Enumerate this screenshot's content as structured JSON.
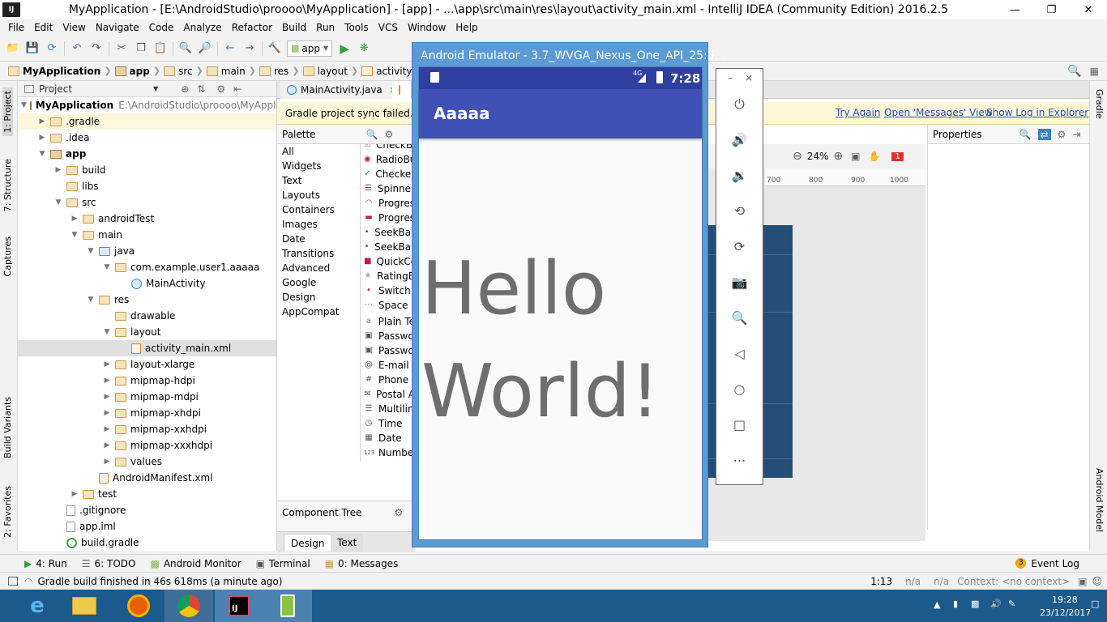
{
  "window": {
    "title": "MyApplication - [E:\\AndroidStudio\\proooo\\MyApplication] - [app] - ...\\app\\src\\main\\res\\layout\\activity_main.xml - IntelliJ IDEA (Community Edition) 2016.2.5",
    "min": "—",
    "max": "❐",
    "close": "✕"
  },
  "menu": [
    "File",
    "Edit",
    "View",
    "Navigate",
    "Code",
    "Analyze",
    "Refactor",
    "Build",
    "Run",
    "Tools",
    "VCS",
    "Window",
    "Help"
  ],
  "toolbar": {
    "run_config": "app"
  },
  "breadcrumb": [
    "MyApplication",
    "app",
    "src",
    "main",
    "res",
    "layout",
    "activity_main.xml"
  ],
  "left_tabs": [
    "1: Project",
    "7: Structure",
    "Captures",
    "Build Variants",
    "2: Favorites"
  ],
  "right_tabs": [
    "Gradle",
    "Android Model"
  ],
  "project_panel": {
    "header": "Project",
    "root_label": "MyApplication",
    "root_path": "E:\\AndroidStudio\\proooo\\MyApplica",
    "items": [
      ".gradle",
      ".idea",
      "app",
      "build",
      "libs",
      "src",
      "androidTest",
      "main",
      "java",
      "com.example.user1.aaaaa",
      "MainActivity",
      "res",
      "drawable",
      "layout",
      "activity_main.xml",
      "layout-xlarge",
      "mipmap-hdpi",
      "mipmap-mdpi",
      "mipmap-xhdpi",
      "mipmap-xxhdpi",
      "mipmap-xxxhdpi",
      "values",
      "AndroidManifest.xml",
      "test",
      ".gitignore",
      "app.iml",
      "build.gradle"
    ]
  },
  "editor_tabs": [
    "MainActivity.java"
  ],
  "notification": {
    "message": "Gradle project sync failed. Bas",
    "actions": [
      "Try Again",
      "Open 'Messages' View",
      "Show Log in Explorer"
    ]
  },
  "palette": {
    "header": "Palette",
    "categories": [
      "All",
      "Widgets",
      "Text",
      "Layouts",
      "Containers",
      "Images",
      "Date",
      "Transitions",
      "Advanced",
      "Google",
      "Design",
      "AppCompat"
    ],
    "items": [
      "CheckBo",
      "RadioBu",
      "Checked",
      "Spinner",
      "Progres",
      "Progres",
      "SeekBar",
      "SeekBar",
      "QuickCo",
      "RatingB",
      "Switch",
      "Space",
      "Plain Te",
      "Passwo",
      "Passwo",
      "E-mail",
      "Phone",
      "Postal A",
      "Multilin",
      "Time",
      "Date",
      "Numbe"
    ]
  },
  "component_tree": {
    "header": "Component Tree"
  },
  "design_tabs": [
    "Design",
    "Text"
  ],
  "canvas": {
    "zoom": "24%",
    "ruler": [
      "700",
      "800",
      "900",
      "1000"
    ],
    "badge": "1"
  },
  "properties": {
    "header": "Properties"
  },
  "emulator": {
    "title": "Android Emulator - 3.7_WVGA_Nexus_One_API_25:5...",
    "time": "7:28",
    "network": "4G",
    "app_title": "Aaaaa",
    "hello_line1": "Hello",
    "hello_line2": "World!"
  },
  "bottom_tabs": [
    "4: Run",
    "6: TODO",
    "Android Monitor",
    "Terminal",
    "0: Messages"
  ],
  "event_log": {
    "count": "3",
    "label": "Event Log"
  },
  "status": {
    "message": "Gradle build finished in 46s 618ms (a minute ago)",
    "position": "1:13",
    "na1": "n/a",
    "na2": "n/a",
    "context": "Context: <no context>"
  },
  "taskbar": {
    "time": "19:28",
    "date": "23/12/2017"
  }
}
